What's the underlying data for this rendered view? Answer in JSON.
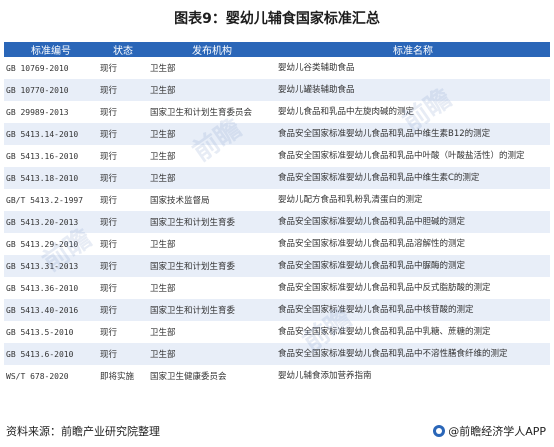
{
  "title": "图表9：婴幼儿辅食国家标准汇总",
  "table": {
    "headers": [
      "标准编号",
      "状态",
      "发布机构",
      "标准名称"
    ],
    "rows": [
      [
        "GB 10769-2010",
        "现行",
        "卫生部",
        "婴幼儿谷类辅助食品"
      ],
      [
        "GB 10770-2010",
        "现行",
        "卫生部",
        "婴幼儿罐装辅助食品"
      ],
      [
        "GB 29989-2013",
        "现行",
        "国家卫生和计划生育委员会",
        "婴幼儿食品和乳品中左旋肉碱的测定"
      ],
      [
        "GB 5413.14-2010",
        "现行",
        "卫生部",
        "食品安全国家标准婴幼儿食品和乳品中维生素B12的测定"
      ],
      [
        "GB 5413.16-2010",
        "现行",
        "卫生部",
        "食品安全国家标准婴幼儿食品和乳品中叶酸（叶酸盐活性）的测定"
      ],
      [
        "GB 5413.18-2010",
        "现行",
        "卫生部",
        "食品安全国家标准婴幼儿食品和乳品中维生素C的测定"
      ],
      [
        "GB/T 5413.2-1997",
        "现行",
        "国家技术监督局",
        "婴幼儿配方食品和乳粉乳清蛋白的测定"
      ],
      [
        "GB 5413.20-2013",
        "现行",
        "国家卫生和计划生育委",
        "食品安全国家标准婴幼儿食品和乳品中胆碱的测定"
      ],
      [
        "GB 5413.29-2010",
        "现行",
        "卫生部",
        "食品安全国家标准婴幼儿食品和乳品溶解性的测定"
      ],
      [
        "GB 5413.31-2013",
        "现行",
        "国家卫生和计划生育委",
        "食品安全国家标准婴幼儿食品和乳品中脲酶的测定"
      ],
      [
        "GB 5413.36-2010",
        "现行",
        "卫生部",
        "食品安全国家标准婴幼儿食品和乳品中反式脂肪酸的测定"
      ],
      [
        "GB 5413.40-2016",
        "现行",
        "国家卫生和计划生育委",
        "食品安全国家标准婴幼儿食品和乳品中核苷酸的测定"
      ],
      [
        "GB 5413.5-2010",
        "现行",
        "卫生部",
        "食品安全国家标准婴幼儿食品和乳品中乳糖、蔗糖的测定"
      ],
      [
        "GB 5413.6-2010",
        "现行",
        "卫生部",
        "食品安全国家标准婴幼儿食品和乳品中不溶性膳食纤维的测定"
      ],
      [
        "WS/T 678-2020",
        "即将实施",
        "国家卫生健康委员会",
        "婴幼儿辅食添加营养指南"
      ]
    ]
  },
  "footer": {
    "source": "资料来源：前瞻产业研究院整理",
    "brand": "@前瞻经济学人APP"
  },
  "colors": {
    "header_bg": "#2a66b8",
    "row_alt_bg": "#e8eef8"
  }
}
